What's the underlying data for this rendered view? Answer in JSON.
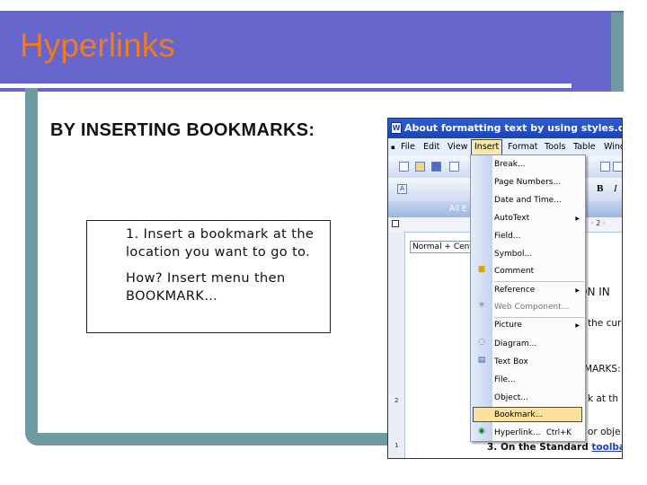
{
  "slide": {
    "title": "Hyperlinks",
    "heading": "BY INSERTING BOOKMARKS:",
    "note_line1": "1. Insert a bookmark at the location you want to go to.",
    "note_line2": "How? Insert menu then BOOKMARK…"
  },
  "colors": {
    "band": "#6666cc",
    "frame": "#6f9ba0",
    "title": "#f07a24"
  },
  "screenshot": {
    "window_title": "About formatting text by using styles.doc - Micro",
    "menu_bar": [
      "File",
      "Edit",
      "View",
      "Insert",
      "Format",
      "Tools",
      "Table",
      "Wind"
    ],
    "style_box": "Normal + Cent",
    "toolbar_text": "All E",
    "bold_label": "B",
    "italic_label": "I",
    "ruler_text": "· 2 ·",
    "insert_menu": {
      "items": [
        {
          "label": "Break...",
          "icon": ""
        },
        {
          "label": "Page Numbers...",
          "icon": ""
        },
        {
          "label": "Date and Time...",
          "icon": ""
        },
        {
          "label": "AutoText",
          "icon": "",
          "submenu": "true"
        },
        {
          "label": "Field...",
          "icon": ""
        },
        {
          "label": "Symbol...",
          "icon": ""
        },
        {
          "label": "Comment",
          "icon": "comment-icon"
        },
        {
          "label": "Reference",
          "icon": "",
          "submenu": "true"
        },
        {
          "label": "Web Component...",
          "icon": "web-component-icon"
        },
        {
          "label": "Picture",
          "icon": "",
          "submenu": "true"
        },
        {
          "label": "Diagram...",
          "icon": "diagram-icon"
        },
        {
          "label": "Text Box",
          "icon": "text-box-icon"
        },
        {
          "label": "File...",
          "icon": ""
        },
        {
          "label": "Object...",
          "icon": ""
        },
        {
          "label": "Bookmark...",
          "icon": ""
        },
        {
          "label": "Hyperlink...",
          "icon": "hyperlink-icon",
          "shortcut": "Ctrl+K"
        }
      ]
    },
    "doc_fragments": [
      "ON IN",
      "the cur",
      "MARKS:",
      "k at th",
      "or obje",
      "3.  On the Standard",
      "toolba"
    ],
    "vruler_marks": [
      "2",
      "1"
    ]
  }
}
